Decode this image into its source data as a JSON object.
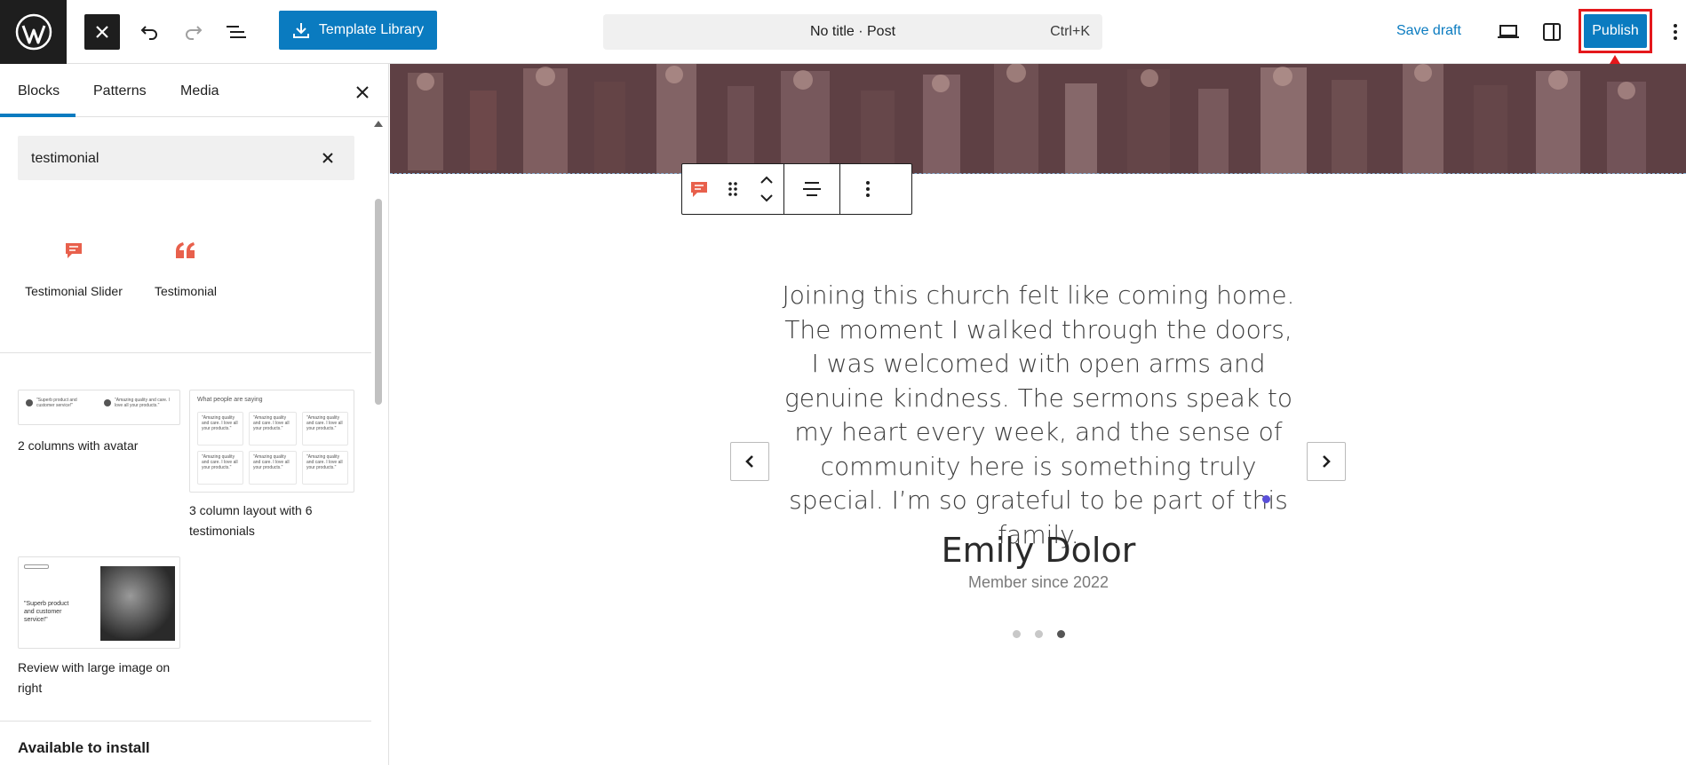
{
  "topbar": {
    "template_library_label": "Template Library",
    "command_title": "No title · Post",
    "command_shortcut": "Ctrl+K",
    "save_draft_label": "Save draft",
    "publish_label": "Publish"
  },
  "sidebar": {
    "tabs": [
      {
        "label": "Blocks",
        "active": true
      },
      {
        "label": "Patterns",
        "active": false
      },
      {
        "label": "Media",
        "active": false
      }
    ],
    "search": {
      "value": "testimonial"
    },
    "blocks": [
      {
        "label": "Testimonial Slider",
        "icon": "speech-bubble-icon"
      },
      {
        "label": "Testimonial",
        "icon": "quote-mark-icon"
      }
    ],
    "patterns": [
      {
        "label": "2 columns with avatar"
      },
      {
        "label": "3 column layout with 6 testimonials"
      },
      {
        "label": "Review with large image on right"
      }
    ],
    "pattern_previews": {
      "p1_col1": "\"Superb product and customer service!\"",
      "p1_col2": "\"Amazing quality and care. I love all your products.\"",
      "p2_title": "What people are saying",
      "p2_card": "\"Amazing quality and care. I love all your products.\"",
      "p3_quote": "\"Superb product and customer service!\""
    },
    "available_to_install": "Available to install"
  },
  "canvas": {
    "quote": "Joining this church felt like coming home. The moment I walked through the doors, I was welcomed with open arms and genuine kindness. The sermons speak to my heart every week, and the sense of community here is something truly special. I’m so grateful to be part of this family.",
    "author": "Emily Dolor",
    "member_since": "Member since 2022",
    "slider": {
      "total_dots": 3,
      "active_dot": 3
    }
  },
  "colors": {
    "accent": "#0a7bc0",
    "dark": "#1e1e1e",
    "annotation_red": "#e4181c",
    "block_icon": "#e8604c"
  }
}
